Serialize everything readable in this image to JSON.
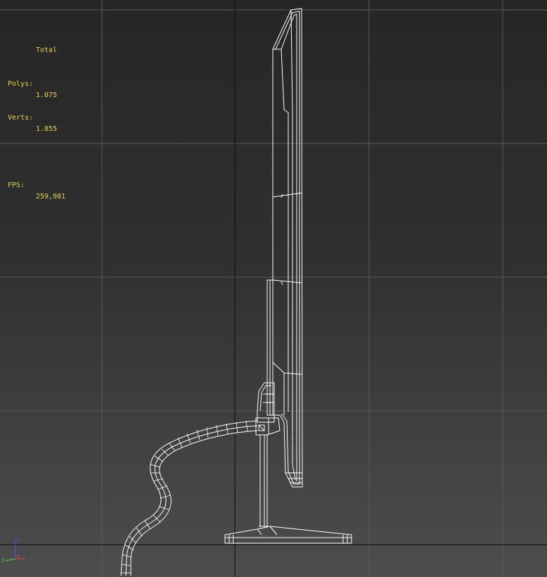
{
  "viewport": {
    "name": "perspective-wireframe-viewport",
    "background_top": "#262626",
    "background_bottom": "#4d4d4d",
    "grid_color": "#5b5b5b",
    "home_grid_axis_color": "#0a0a0a",
    "wire_color": "#ffffff"
  },
  "stats": {
    "header": "Total",
    "polys_label": "Polys:",
    "polys_value": "1.075",
    "verts_label": "Verts:",
    "verts_value": "1.855",
    "fps_label": "FPS:",
    "fps_value": "259,981",
    "text_color": "#e8d24a"
  },
  "gizmo": {
    "z_label": "z",
    "x_label": "x",
    "y_label": "y",
    "z_color": "#3f55e0",
    "x_color": "#e04040",
    "y_color": "#40c040"
  }
}
